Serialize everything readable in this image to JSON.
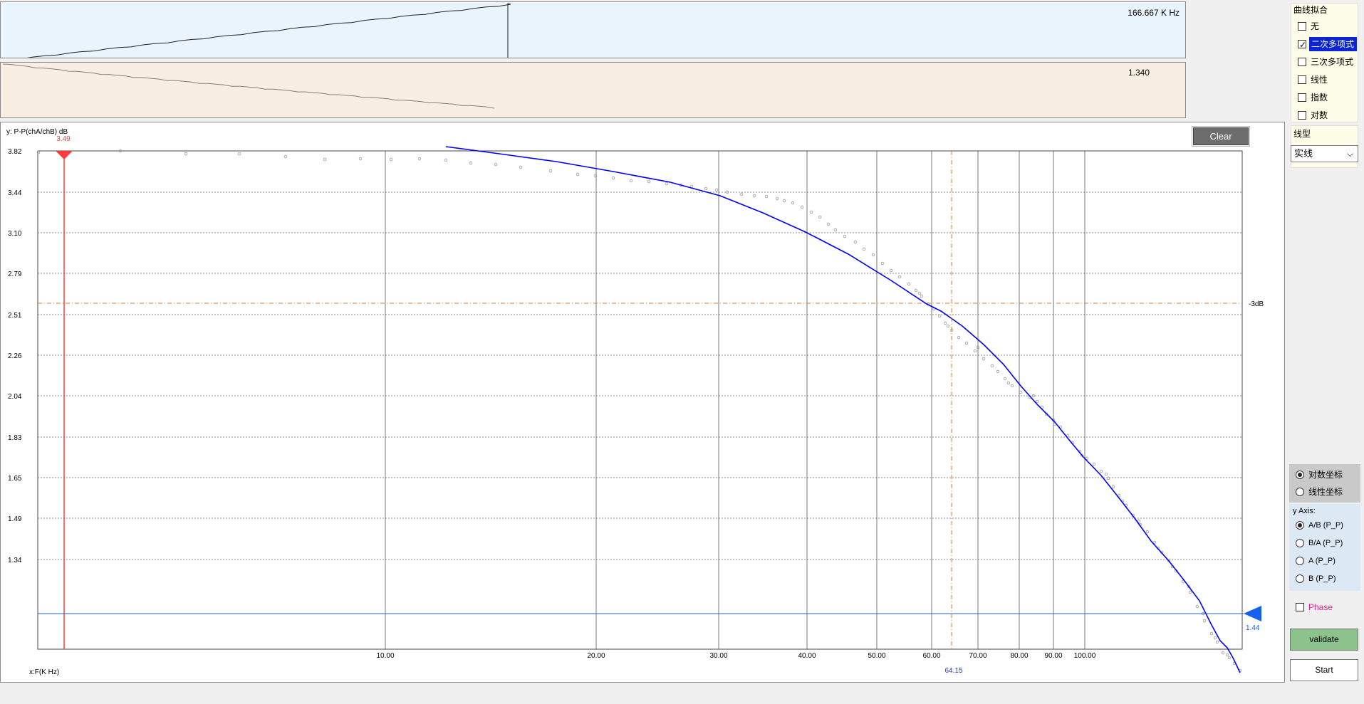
{
  "top_strips": {
    "freq_value": "166.667 K Hz",
    "ratio_value": "1.340"
  },
  "plot": {
    "y_axis_label": "y: P-P(chA/chB) dB",
    "x_axis_label": "x:F(K Hz)",
    "clear_label": "Clear",
    "y_ticks": [
      "3.82",
      "3.44",
      "3.10",
      "2.79",
      "2.51",
      "2.26",
      "2.04",
      "1.83",
      "1.65",
      "1.49",
      "1.34"
    ],
    "x_ticks": [
      "10.00",
      "20.00",
      "30.00",
      "40.00",
      "50.00",
      "60.00",
      "70.00",
      "80.00",
      "90.00",
      "100.00"
    ],
    "minus3db_label": "-3dB",
    "cursor_x_value": "3.49",
    "marker_y_value": "1.44",
    "cursor_64_label": "64.15",
    "colors": {
      "fit_line": "#0000ff",
      "red_cursor": "#ff3b3b",
      "marker": "#1560f0",
      "ref_line": "#d97b35"
    }
  },
  "curve_fit": {
    "title": "曲线拟合",
    "options": [
      {
        "label": "无",
        "checked": false
      },
      {
        "label": "二次多项式",
        "checked": true
      },
      {
        "label": "三次多项式",
        "checked": false
      },
      {
        "label": "线性",
        "checked": false
      },
      {
        "label": "指数",
        "checked": false
      },
      {
        "label": "对数",
        "checked": false
      }
    ]
  },
  "line_type": {
    "title": "线型",
    "selected": "实线"
  },
  "scale": {
    "options": [
      {
        "label": "对数坐标",
        "selected": true
      },
      {
        "label": "线性坐标",
        "selected": false
      }
    ]
  },
  "y_axis": {
    "title": "y Axis:",
    "options": [
      {
        "label": "A/B (P_P)",
        "selected": true
      },
      {
        "label": "B/A (P_P)",
        "selected": false
      },
      {
        "label": "A (P_P)",
        "selected": false
      },
      {
        "label": "B (P_P)",
        "selected": false
      }
    ]
  },
  "phase": {
    "label": "Phase",
    "checked": false
  },
  "buttons": {
    "validate": "validate",
    "start": "Start"
  }
}
